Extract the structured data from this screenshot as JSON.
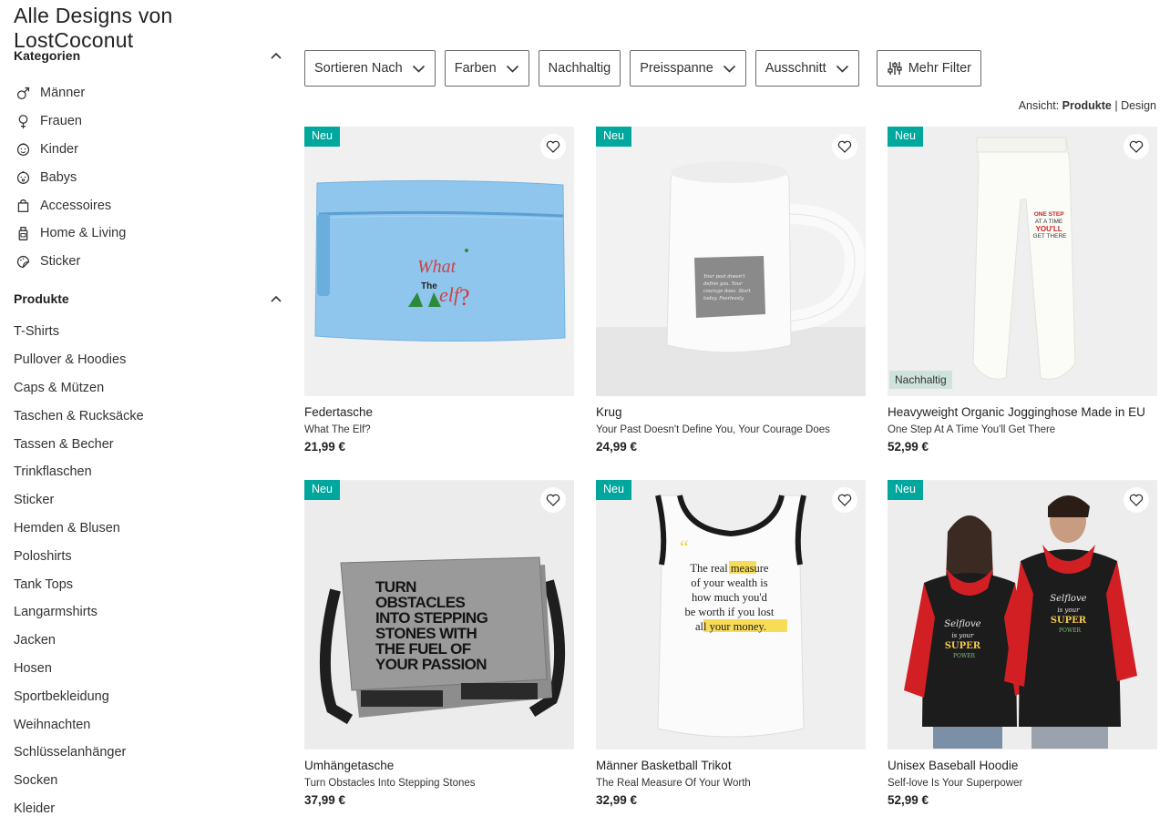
{
  "page_title": "Alle Designs von LostCoconut",
  "sidebar": {
    "categories_title": "Kategorien",
    "categories": [
      {
        "label": "Männer",
        "icon": "male-icon"
      },
      {
        "label": "Frauen",
        "icon": "female-icon"
      },
      {
        "label": "Kinder",
        "icon": "kid-face-icon"
      },
      {
        "label": "Babys",
        "icon": "baby-face-icon"
      },
      {
        "label": "Accessoires",
        "icon": "bag-icon"
      },
      {
        "label": "Home & Living",
        "icon": "bottle-icon"
      },
      {
        "label": "Sticker",
        "icon": "sticker-icon"
      }
    ],
    "products_title": "Produkte",
    "products": [
      "T-Shirts",
      "Pullover & Hoodies",
      "Caps & Mützen",
      "Taschen & Rucksäcke",
      "Tassen & Becher",
      "Trinkflaschen",
      "Sticker",
      "Hemden & Blusen",
      "Poloshirts",
      "Tank Tops",
      "Langarmshirts",
      "Jacken",
      "Hosen",
      "Sportbekleidung",
      "Weihnachten",
      "Schlüsselanhänger",
      "Socken",
      "Kleider"
    ]
  },
  "filters": {
    "sort": "Sortieren Nach",
    "colors": "Farben",
    "sustainable": "Nachhaltig",
    "price_range": "Preisspanne",
    "neckline": "Ausschnitt",
    "more": "Mehr Filter"
  },
  "view": {
    "label": "Ansicht:",
    "products": "Produkte",
    "separator": "|",
    "design": "Design"
  },
  "badge_new": "Neu",
  "badge_sustainable": "Nachhaltig",
  "products": [
    {
      "name": "Federtasche",
      "design": "What The Elf?",
      "price": "21,99 €",
      "art_text": [
        "What",
        "The",
        "elf",
        "?"
      ]
    },
    {
      "name": "Krug",
      "design": "Your Past Doesn't Define You, Your Courage Does",
      "price": "24,99 €",
      "art_text": [
        "Your past doesn't",
        "define you. Your",
        "courage does. Start",
        "today. Fearlessly."
      ]
    },
    {
      "name": "Heavyweight Organic Jogginghose Made in EU",
      "design": "One Step At A Time You'll Get There",
      "price": "52,99 €",
      "art_text": [
        "ONE STEP",
        "AT A TIME",
        "YOU'LL",
        "GET THERE"
      ]
    },
    {
      "name": "Umhängetasche",
      "design": "Turn Obstacles Into Stepping Stones",
      "price": "37,99 €",
      "art_text": [
        "TURN",
        "OBSTACLES",
        "INTO STEPPING",
        "STONES WITH",
        "THE FUEL OF",
        "YOUR PASSION"
      ]
    },
    {
      "name": "Männer Basketball Trikot",
      "design": "The Real Measure Of Your Worth",
      "price": "32,99 €",
      "art_text": [
        "The real measure",
        "of your wealth is",
        "how much you'd",
        "be worth if you lost",
        "all your money."
      ]
    },
    {
      "name": "Unisex Baseball Hoodie",
      "design": "Self-love Is Your Superpower",
      "price": "52,99 €",
      "art_text": [
        "Selflove",
        "is your",
        "SUPER",
        "POWER"
      ]
    }
  ]
}
